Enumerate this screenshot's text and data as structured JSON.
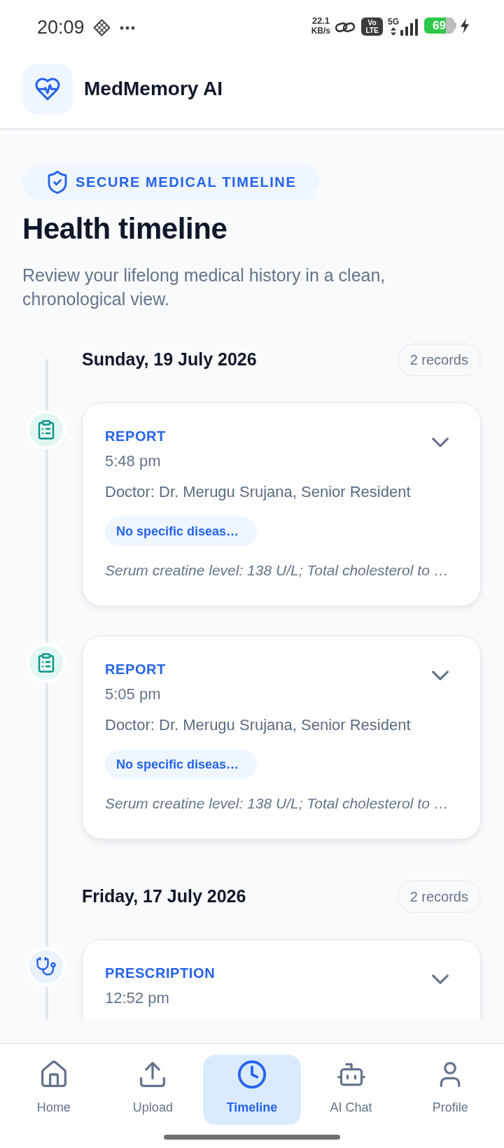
{
  "status_bar": {
    "time": "20:09",
    "speed": "22.1",
    "speed_unit": "KB/s",
    "volte": [
      "Vo",
      "LTE"
    ],
    "network": "5G",
    "battery": "69",
    "charging": true
  },
  "app_bar": {
    "title": "MedMemory AI"
  },
  "hero": {
    "badge": "SECURE MEDICAL TIMELINE",
    "title": "Health timeline",
    "subtitle": "Review your lifelong medical history in a clean, chronological view."
  },
  "timeline": [
    {
      "date": "Sunday, 19 July 2026",
      "count": "2 records",
      "records": [
        {
          "kind": "report",
          "type": "REPORT",
          "time": "5:48 pm",
          "doctor": "Doctor: Dr. Merugu Srujana, Senior Resident",
          "tag": "No specific diseas…",
          "summary": "Serum creatine level: 138 U/L; Total cholesterol to …",
          "expanded": false
        },
        {
          "kind": "report",
          "type": "REPORT",
          "time": "5:05 pm",
          "doctor": "Doctor: Dr. Merugu Srujana, Senior Resident",
          "tag": "No specific diseas…",
          "summary": "Serum creatine level: 138 U/L; Total cholesterol to …",
          "expanded": false
        }
      ]
    },
    {
      "date": "Friday, 17 July 2026",
      "count": "2 records",
      "records": [
        {
          "kind": "prescription",
          "type": "PRESCRIPTION",
          "time": "12:52 pm",
          "expanded": false
        }
      ]
    }
  ],
  "bottom_nav": [
    {
      "kind": "home",
      "label": "Home",
      "selected": false
    },
    {
      "kind": "upload",
      "label": "Upload",
      "selected": false
    },
    {
      "kind": "timeline",
      "label": "Timeline",
      "selected": true
    },
    {
      "kind": "ai_chat",
      "label": "AI Chat",
      "selected": false
    },
    {
      "kind": "profile",
      "label": "Profile",
      "selected": false
    }
  ]
}
